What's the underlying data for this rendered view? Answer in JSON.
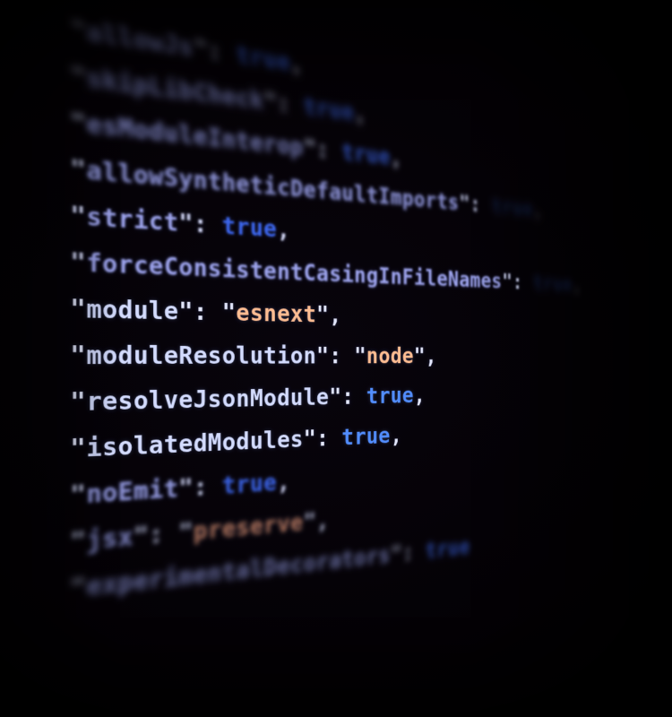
{
  "code": {
    "lines": [
      {
        "key": "allowJs",
        "kind": "bool",
        "value": "true",
        "comma": true
      },
      {
        "key": "skipLibCheck",
        "kind": "bool",
        "value": "true",
        "comma": true
      },
      {
        "key": "esModuleInterop",
        "kind": "bool",
        "value": "true",
        "comma": true
      },
      {
        "key": "allowSyntheticDefaultImports",
        "kind": "bool",
        "value": "true",
        "comma": true
      },
      {
        "key": "strict",
        "kind": "bool",
        "value": "true",
        "comma": true
      },
      {
        "key": "forceConsistentCasingInFileNames",
        "kind": "bool",
        "value": "true",
        "comma": true
      },
      {
        "key": "module",
        "kind": "string",
        "value": "esnext",
        "comma": true
      },
      {
        "key": "moduleResolution",
        "kind": "string",
        "value": "node",
        "comma": true
      },
      {
        "key": "resolveJsonModule",
        "kind": "bool",
        "value": "true",
        "comma": true
      },
      {
        "key": "isolatedModules",
        "kind": "bool",
        "value": "true",
        "comma": true
      },
      {
        "key": "noEmit",
        "kind": "bool",
        "value": "true",
        "comma": true
      },
      {
        "key": "jsx",
        "kind": "string",
        "value": "preserve",
        "comma": true
      },
      {
        "key": "experimentalDecorators",
        "kind": "bool",
        "value": "true",
        "comma": false
      }
    ]
  }
}
